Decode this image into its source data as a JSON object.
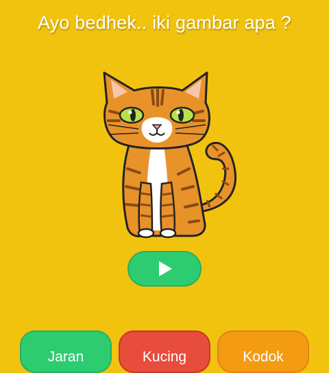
{
  "question": "Ayo bedhek.. iki gambar apa ?",
  "picture": {
    "icon": "cat-illustration"
  },
  "play_button": {
    "icon": "play-icon"
  },
  "answers": [
    {
      "label": "Jaran",
      "color": "#2ECC71"
    },
    {
      "label": "Kucing",
      "color": "#E74C3C"
    },
    {
      "label": "Kodok",
      "color": "#F39C12"
    }
  ],
  "colors": {
    "background": "#F1C30F",
    "text": "#FFFFFF"
  }
}
